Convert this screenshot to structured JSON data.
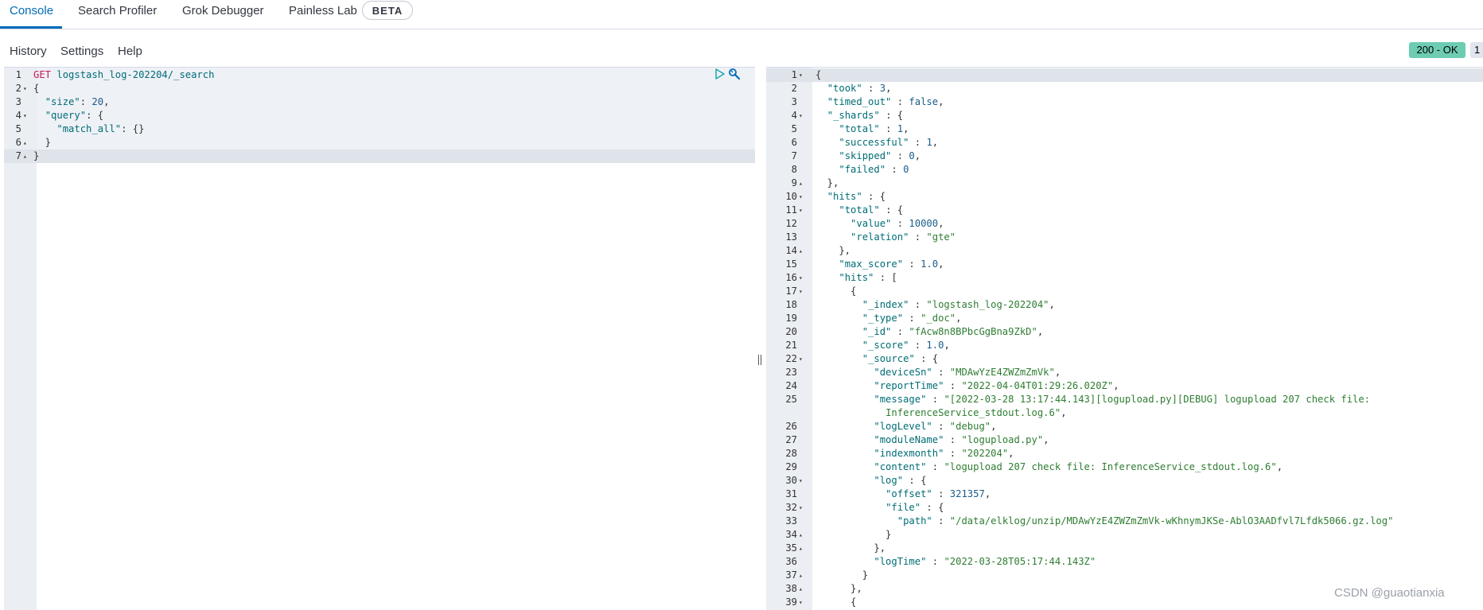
{
  "tabs": [
    {
      "label": "Console",
      "active": true
    },
    {
      "label": "Search Profiler"
    },
    {
      "label": "Grok Debugger"
    },
    {
      "label": "Painless Lab"
    }
  ],
  "beta_badge": "BETA",
  "menu": [
    "History",
    "Settings",
    "Help"
  ],
  "status": {
    "label": "200 - OK",
    "color": "#6dccb1"
  },
  "gray_badge": "1",
  "watermark": "CSDN @guaotianxia",
  "icons": {
    "run": "play-icon",
    "settings": "wrench-icon"
  },
  "request": {
    "lines": [
      {
        "n": "1",
        "fold": "",
        "tokens": [
          [
            "m",
            "GET"
          ],
          [
            "p",
            " "
          ],
          [
            "u",
            "logstash_log-202204/_search"
          ]
        ]
      },
      {
        "n": "2",
        "fold": "▾",
        "tokens": [
          [
            "p",
            "{"
          ]
        ]
      },
      {
        "n": "3",
        "fold": "",
        "tokens": [
          [
            "p",
            "  "
          ],
          [
            "k",
            "\"size\""
          ],
          [
            "p",
            ": "
          ],
          [
            "n",
            "20"
          ],
          [
            "p",
            ","
          ]
        ]
      },
      {
        "n": "4",
        "fold": "▾",
        "tokens": [
          [
            "p",
            "  "
          ],
          [
            "k",
            "\"query\""
          ],
          [
            "p",
            ": {"
          ]
        ]
      },
      {
        "n": "5",
        "fold": "",
        "tokens": [
          [
            "p",
            "    "
          ],
          [
            "k",
            "\"match_all\""
          ],
          [
            "p",
            ": {}"
          ]
        ]
      },
      {
        "n": "6",
        "fold": "▴",
        "tokens": [
          [
            "p",
            "  }"
          ]
        ]
      },
      {
        "n": "7",
        "fold": "▴",
        "tokens": [
          [
            "p",
            "}"
          ]
        ]
      }
    ]
  },
  "response": {
    "lines": [
      {
        "n": "1",
        "fold": "▾",
        "tokens": [
          [
            "p",
            "{"
          ]
        ]
      },
      {
        "n": "2",
        "fold": "",
        "tokens": [
          [
            "p",
            "  "
          ],
          [
            "k",
            "\"took\""
          ],
          [
            "p",
            " : "
          ],
          [
            "n",
            "3"
          ],
          [
            "p",
            ","
          ]
        ]
      },
      {
        "n": "3",
        "fold": "",
        "tokens": [
          [
            "p",
            "  "
          ],
          [
            "k",
            "\"timed_out\""
          ],
          [
            "p",
            " : "
          ],
          [
            "b",
            "false"
          ],
          [
            "p",
            ","
          ]
        ]
      },
      {
        "n": "4",
        "fold": "▾",
        "tokens": [
          [
            "p",
            "  "
          ],
          [
            "k",
            "\"_shards\""
          ],
          [
            "p",
            " : {"
          ]
        ]
      },
      {
        "n": "5",
        "fold": "",
        "tokens": [
          [
            "p",
            "    "
          ],
          [
            "k",
            "\"total\""
          ],
          [
            "p",
            " : "
          ],
          [
            "n",
            "1"
          ],
          [
            "p",
            ","
          ]
        ]
      },
      {
        "n": "6",
        "fold": "",
        "tokens": [
          [
            "p",
            "    "
          ],
          [
            "k",
            "\"successful\""
          ],
          [
            "p",
            " : "
          ],
          [
            "n",
            "1"
          ],
          [
            "p",
            ","
          ]
        ]
      },
      {
        "n": "7",
        "fold": "",
        "tokens": [
          [
            "p",
            "    "
          ],
          [
            "k",
            "\"skipped\""
          ],
          [
            "p",
            " : "
          ],
          [
            "n",
            "0"
          ],
          [
            "p",
            ","
          ]
        ]
      },
      {
        "n": "8",
        "fold": "",
        "tokens": [
          [
            "p",
            "    "
          ],
          [
            "k",
            "\"failed\""
          ],
          [
            "p",
            " : "
          ],
          [
            "n",
            "0"
          ]
        ]
      },
      {
        "n": "9",
        "fold": "▴",
        "tokens": [
          [
            "p",
            "  },"
          ]
        ]
      },
      {
        "n": "10",
        "fold": "▾",
        "tokens": [
          [
            "p",
            "  "
          ],
          [
            "k",
            "\"hits\""
          ],
          [
            "p",
            " : {"
          ]
        ]
      },
      {
        "n": "11",
        "fold": "▾",
        "tokens": [
          [
            "p",
            "    "
          ],
          [
            "k",
            "\"total\""
          ],
          [
            "p",
            " : {"
          ]
        ]
      },
      {
        "n": "12",
        "fold": "",
        "tokens": [
          [
            "p",
            "      "
          ],
          [
            "k",
            "\"value\""
          ],
          [
            "p",
            " : "
          ],
          [
            "n",
            "10000"
          ],
          [
            "p",
            ","
          ]
        ]
      },
      {
        "n": "13",
        "fold": "",
        "tokens": [
          [
            "p",
            "      "
          ],
          [
            "k",
            "\"relation\""
          ],
          [
            "p",
            " : "
          ],
          [
            "s",
            "\"gte\""
          ]
        ]
      },
      {
        "n": "14",
        "fold": "▴",
        "tokens": [
          [
            "p",
            "    },"
          ]
        ]
      },
      {
        "n": "15",
        "fold": "",
        "tokens": [
          [
            "p",
            "    "
          ],
          [
            "k",
            "\"max_score\""
          ],
          [
            "p",
            " : "
          ],
          [
            "n",
            "1.0"
          ],
          [
            "p",
            ","
          ]
        ]
      },
      {
        "n": "16",
        "fold": "▾",
        "tokens": [
          [
            "p",
            "    "
          ],
          [
            "k",
            "\"hits\""
          ],
          [
            "p",
            " : ["
          ]
        ]
      },
      {
        "n": "17",
        "fold": "▾",
        "tokens": [
          [
            "p",
            "      {"
          ]
        ]
      },
      {
        "n": "18",
        "fold": "",
        "tokens": [
          [
            "p",
            "        "
          ],
          [
            "k",
            "\"_index\""
          ],
          [
            "p",
            " : "
          ],
          [
            "s",
            "\"logstash_log-202204\""
          ],
          [
            "p",
            ","
          ]
        ]
      },
      {
        "n": "19",
        "fold": "",
        "tokens": [
          [
            "p",
            "        "
          ],
          [
            "k",
            "\"_type\""
          ],
          [
            "p",
            " : "
          ],
          [
            "s",
            "\"_doc\""
          ],
          [
            "p",
            ","
          ]
        ]
      },
      {
        "n": "20",
        "fold": "",
        "tokens": [
          [
            "p",
            "        "
          ],
          [
            "k",
            "\"_id\""
          ],
          [
            "p",
            " : "
          ],
          [
            "s",
            "\"fAcw8n8BPbcGgBna9ZkD\""
          ],
          [
            "p",
            ","
          ]
        ]
      },
      {
        "n": "21",
        "fold": "",
        "tokens": [
          [
            "p",
            "        "
          ],
          [
            "k",
            "\"_score\""
          ],
          [
            "p",
            " : "
          ],
          [
            "n",
            "1.0"
          ],
          [
            "p",
            ","
          ]
        ]
      },
      {
        "n": "22",
        "fold": "▾",
        "tokens": [
          [
            "p",
            "        "
          ],
          [
            "k",
            "\"_source\""
          ],
          [
            "p",
            " : {"
          ]
        ]
      },
      {
        "n": "23",
        "fold": "",
        "tokens": [
          [
            "p",
            "          "
          ],
          [
            "k",
            "\"deviceSn\""
          ],
          [
            "p",
            " : "
          ],
          [
            "s",
            "\"MDAwYzE4ZWZmZmVk\""
          ],
          [
            "p",
            ","
          ]
        ]
      },
      {
        "n": "24",
        "fold": "",
        "tokens": [
          [
            "p",
            "          "
          ],
          [
            "k",
            "\"reportTime\""
          ],
          [
            "p",
            " : "
          ],
          [
            "s",
            "\"2022-04-04T01:29:26.020Z\""
          ],
          [
            "p",
            ","
          ]
        ]
      },
      {
        "n": "25",
        "fold": "",
        "tokens": [
          [
            "p",
            "          "
          ],
          [
            "k",
            "\"message\""
          ],
          [
            "p",
            " : "
          ],
          [
            "s",
            "\"[2022-03-28 13:17:44.143][logupload.py][DEBUG] logupload 207 check file:"
          ]
        ]
      },
      {
        "n": "",
        "fold": "",
        "tokens": [
          [
            "p",
            "            "
          ],
          [
            "s",
            "InferenceService_stdout.log.6\""
          ],
          [
            "p",
            ","
          ]
        ]
      },
      {
        "n": "26",
        "fold": "",
        "tokens": [
          [
            "p",
            "          "
          ],
          [
            "k",
            "\"logLevel\""
          ],
          [
            "p",
            " : "
          ],
          [
            "s",
            "\"debug\""
          ],
          [
            "p",
            ","
          ]
        ]
      },
      {
        "n": "27",
        "fold": "",
        "tokens": [
          [
            "p",
            "          "
          ],
          [
            "k",
            "\"moduleName\""
          ],
          [
            "p",
            " : "
          ],
          [
            "s",
            "\"logupload.py\""
          ],
          [
            "p",
            ","
          ]
        ]
      },
      {
        "n": "28",
        "fold": "",
        "tokens": [
          [
            "p",
            "          "
          ],
          [
            "k",
            "\"indexmonth\""
          ],
          [
            "p",
            " : "
          ],
          [
            "s",
            "\"202204\""
          ],
          [
            "p",
            ","
          ]
        ]
      },
      {
        "n": "29",
        "fold": "",
        "tokens": [
          [
            "p",
            "          "
          ],
          [
            "k",
            "\"content\""
          ],
          [
            "p",
            " : "
          ],
          [
            "s",
            "\"logupload 207 check file: InferenceService_stdout.log.6\""
          ],
          [
            "p",
            ","
          ]
        ]
      },
      {
        "n": "30",
        "fold": "▾",
        "tokens": [
          [
            "p",
            "          "
          ],
          [
            "k",
            "\"log\""
          ],
          [
            "p",
            " : {"
          ]
        ]
      },
      {
        "n": "31",
        "fold": "",
        "tokens": [
          [
            "p",
            "            "
          ],
          [
            "k",
            "\"offset\""
          ],
          [
            "p",
            " : "
          ],
          [
            "n",
            "321357"
          ],
          [
            "p",
            ","
          ]
        ]
      },
      {
        "n": "32",
        "fold": "▾",
        "tokens": [
          [
            "p",
            "            "
          ],
          [
            "k",
            "\"file\""
          ],
          [
            "p",
            " : {"
          ]
        ]
      },
      {
        "n": "33",
        "fold": "",
        "tokens": [
          [
            "p",
            "              "
          ],
          [
            "k",
            "\"path\""
          ],
          [
            "p",
            " : "
          ],
          [
            "s",
            "\"/data/elklog/unzip/MDAwYzE4ZWZmZmVk-wKhnymJKSe-AblO3AADfvl7Lfdk5066.gz.log\""
          ]
        ]
      },
      {
        "n": "34",
        "fold": "▴",
        "tokens": [
          [
            "p",
            "            }"
          ]
        ]
      },
      {
        "n": "35",
        "fold": "▴",
        "tokens": [
          [
            "p",
            "          },"
          ]
        ]
      },
      {
        "n": "36",
        "fold": "",
        "tokens": [
          [
            "p",
            "          "
          ],
          [
            "k",
            "\"logTime\""
          ],
          [
            "p",
            " : "
          ],
          [
            "s",
            "\"2022-03-28T05:17:44.143Z\""
          ]
        ]
      },
      {
        "n": "37",
        "fold": "▴",
        "tokens": [
          [
            "p",
            "        }"
          ]
        ]
      },
      {
        "n": "38",
        "fold": "▴",
        "tokens": [
          [
            "p",
            "      },"
          ]
        ]
      },
      {
        "n": "39",
        "fold": "▾",
        "tokens": [
          [
            "p",
            "      {"
          ]
        ]
      }
    ]
  }
}
